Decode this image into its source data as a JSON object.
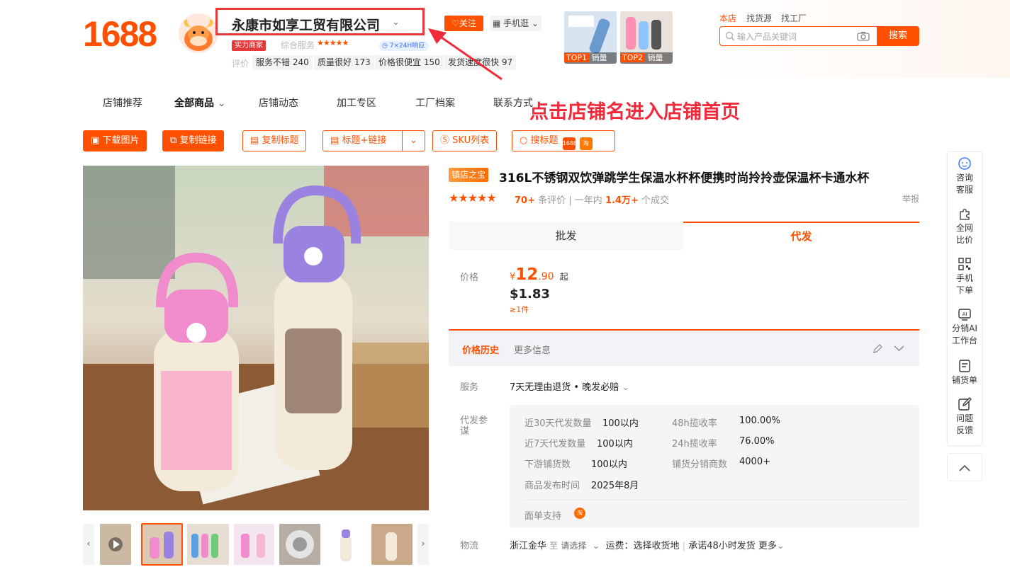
{
  "logo": "1688",
  "store": {
    "name": "永康市如享工贸有限公司",
    "strength_badge": "实力商家",
    "service_label": "综合服务",
    "stars": "★★★★★",
    "badge_24h": "7×24H响应",
    "rating_label": "评价",
    "ratings": [
      "服务不错 240",
      "质量很好 173",
      "价格很便宜 150",
      "发货速度很快 97"
    ],
    "follow": "关注",
    "mobile": "手机逛"
  },
  "top_products": [
    {
      "rank": "TOP1",
      "label": "销量"
    },
    {
      "rank": "TOP2",
      "label": "销量"
    }
  ],
  "search": {
    "tabs": [
      "本店",
      "找货源",
      "找工厂"
    ],
    "placeholder": "输入产品关键词",
    "button": "搜索"
  },
  "nav": [
    "店铺推荐",
    "全部商品",
    "店铺动态",
    "加工专区",
    "工厂档案",
    "联系方式"
  ],
  "annotation": "点击店铺名进入店铺首页",
  "tools": [
    "下载图片",
    "复制链接",
    "复制标题",
    "标题+链接",
    "SKU列表",
    "搜标题"
  ],
  "tool_logos": [
    "1688",
    "淘"
  ],
  "product": {
    "tag": "镇店之宝",
    "title": "316L不锈钢双饮弹跳学生保温水杯杯便携时尚拎拎壶保温杯卡通水杯",
    "reviews_count": "70+",
    "reviews_text": "条评价",
    "year_label": "一年内",
    "sold": "1.4万+",
    "sold_text": "个成交",
    "report": "举报"
  },
  "tabs": {
    "wholesale": "批发",
    "dropship": "代发"
  },
  "price": {
    "label": "价格",
    "currency": "¥",
    "int": "12",
    "dec": ".90",
    "suffix": "起",
    "usd": "$1.83",
    "min": "≥1件"
  },
  "history": {
    "title": "价格历史",
    "more": "更多信息"
  },
  "service": {
    "label": "服务",
    "value": "7天无理由退货 • 晚发必赔"
  },
  "dropship_ref": {
    "label": "代发参谋",
    "rows": [
      {
        "k1": "近30天代发数量",
        "v1": "100以内",
        "k2": "48h揽收率",
        "v2": "100.00%"
      },
      {
        "k1": "近7天代发数量",
        "v1": "100以内",
        "k2": "24h揽收率",
        "v2": "76.00%"
      },
      {
        "k1": "下游铺货数",
        "v1": "100以内",
        "k2": "铺货分销商数",
        "v2": "4000+"
      },
      {
        "k1": "商品发布时间",
        "v1": "2025年8月",
        "k2": "",
        "v2": ""
      }
    ],
    "waybill": "面单支持"
  },
  "logistics": {
    "label": "物流",
    "from": "浙江金华",
    "to_label": "至",
    "to": "请选择",
    "fee": "运费：选择收货地",
    "promise": "承诺48小时发货",
    "more": "更多"
  },
  "rail": [
    {
      "icon": "chat-icon",
      "label": "咨询客服"
    },
    {
      "icon": "puzzle-icon",
      "label": "全网比价"
    },
    {
      "icon": "qrcode-icon",
      "label": "手机下单"
    },
    {
      "icon": "ai-icon",
      "label": "分销AI工作台"
    },
    {
      "icon": "list-icon",
      "label": "铺货单"
    },
    {
      "icon": "edit-icon",
      "label": "问题反馈"
    }
  ],
  "colors": {
    "brand": "#ff5000",
    "annotation": "#f02a3a"
  }
}
